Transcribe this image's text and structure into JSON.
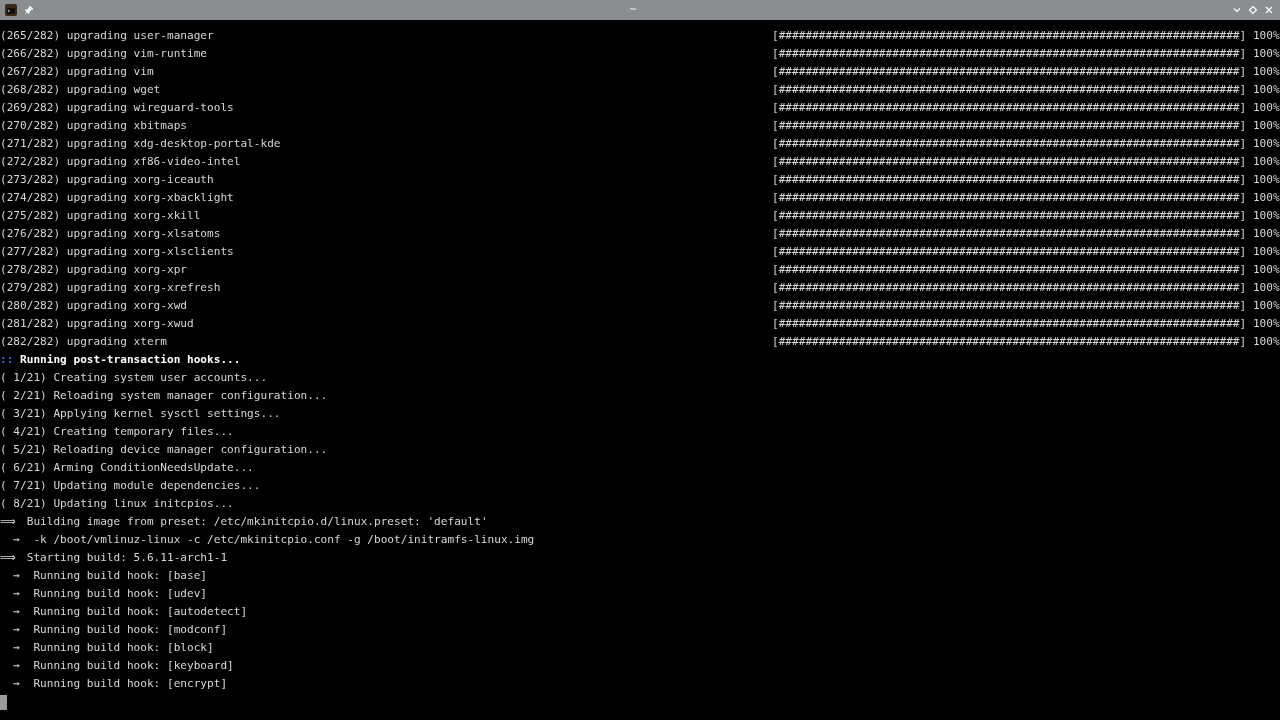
{
  "window": {
    "title": "~"
  },
  "terminal": {
    "progress_rows": [
      {
        "text": "(265/282) upgrading user-manager",
        "bar": "[#####################################################################]",
        "percent": "100%"
      },
      {
        "text": "(266/282) upgrading vim-runtime",
        "bar": "[#####################################################################]",
        "percent": "100%"
      },
      {
        "text": "(267/282) upgrading vim",
        "bar": "[#####################################################################]",
        "percent": "100%"
      },
      {
        "text": "(268/282) upgrading wget",
        "bar": "[#####################################################################]",
        "percent": "100%"
      },
      {
        "text": "(269/282) upgrading wireguard-tools",
        "bar": "[#####################################################################]",
        "percent": "100%"
      },
      {
        "text": "(270/282) upgrading xbitmaps",
        "bar": "[#####################################################################]",
        "percent": "100%"
      },
      {
        "text": "(271/282) upgrading xdg-desktop-portal-kde",
        "bar": "[#####################################################################]",
        "percent": "100%"
      },
      {
        "text": "(272/282) upgrading xf86-video-intel",
        "bar": "[#####################################################################]",
        "percent": "100%"
      },
      {
        "text": "(273/282) upgrading xorg-iceauth",
        "bar": "[#####################################################################]",
        "percent": "100%"
      },
      {
        "text": "(274/282) upgrading xorg-xbacklight",
        "bar": "[#####################################################################]",
        "percent": "100%"
      },
      {
        "text": "(275/282) upgrading xorg-xkill",
        "bar": "[#####################################################################]",
        "percent": "100%"
      },
      {
        "text": "(276/282) upgrading xorg-xlsatoms",
        "bar": "[#####################################################################]",
        "percent": "100%"
      },
      {
        "text": "(277/282) upgrading xorg-xlsclients",
        "bar": "[#####################################################################]",
        "percent": "100%"
      },
      {
        "text": "(278/282) upgrading xorg-xpr",
        "bar": "[#####################################################################]",
        "percent": "100%"
      },
      {
        "text": "(279/282) upgrading xorg-xrefresh",
        "bar": "[#####################################################################]",
        "percent": "100%"
      },
      {
        "text": "(280/282) upgrading xorg-xwd",
        "bar": "[#####################################################################]",
        "percent": "100%"
      },
      {
        "text": "(281/282) upgrading xorg-xwud",
        "bar": "[#####################################################################]",
        "percent": "100%"
      },
      {
        "text": "(282/282) upgrading xterm",
        "bar": "[#####################################################################]",
        "percent": "100%"
      }
    ],
    "lines": [
      {
        "kind": "header",
        "prefix": "::",
        "text": "Running post-transaction hooks..."
      },
      {
        "kind": "plain",
        "text": "( 1/21) Creating system user accounts..."
      },
      {
        "kind": "plain",
        "text": "( 2/21) Reloading system manager configuration..."
      },
      {
        "kind": "plain",
        "text": "( 3/21) Applying kernel sysctl settings..."
      },
      {
        "kind": "plain",
        "text": "( 4/21) Creating temporary files..."
      },
      {
        "kind": "plain",
        "text": "( 5/21) Reloading device manager configuration..."
      },
      {
        "kind": "plain",
        "text": "( 6/21) Arming ConditionNeedsUpdate..."
      },
      {
        "kind": "plain",
        "text": "( 7/21) Updating module dependencies..."
      },
      {
        "kind": "plain",
        "text": "( 8/21) Updating linux initcpios..."
      },
      {
        "kind": "arrow",
        "prefix": "⟹",
        "text": "Building image from preset: /etc/mkinitcpio.d/linux.preset: 'default'"
      },
      {
        "kind": "subarrow",
        "prefix": "→",
        "text": "-k /boot/vmlinuz-linux -c /etc/mkinitcpio.conf -g /boot/initramfs-linux.img"
      },
      {
        "kind": "arrow",
        "prefix": "⟹",
        "text": "Starting build: 5.6.11-arch1-1"
      },
      {
        "kind": "subarrow",
        "prefix": "→",
        "text": "Running build hook: [base]"
      },
      {
        "kind": "subarrow",
        "prefix": "→",
        "text": "Running build hook: [udev]"
      },
      {
        "kind": "subarrow",
        "prefix": "→",
        "text": "Running build hook: [autodetect]"
      },
      {
        "kind": "subarrow",
        "prefix": "→",
        "text": "Running build hook: [modconf]"
      },
      {
        "kind": "subarrow",
        "prefix": "→",
        "text": "Running build hook: [block]"
      },
      {
        "kind": "subarrow",
        "prefix": "→",
        "text": "Running build hook: [keyboard]"
      },
      {
        "kind": "subarrow",
        "prefix": "→",
        "text": "Running build hook: [encrypt]"
      }
    ]
  }
}
